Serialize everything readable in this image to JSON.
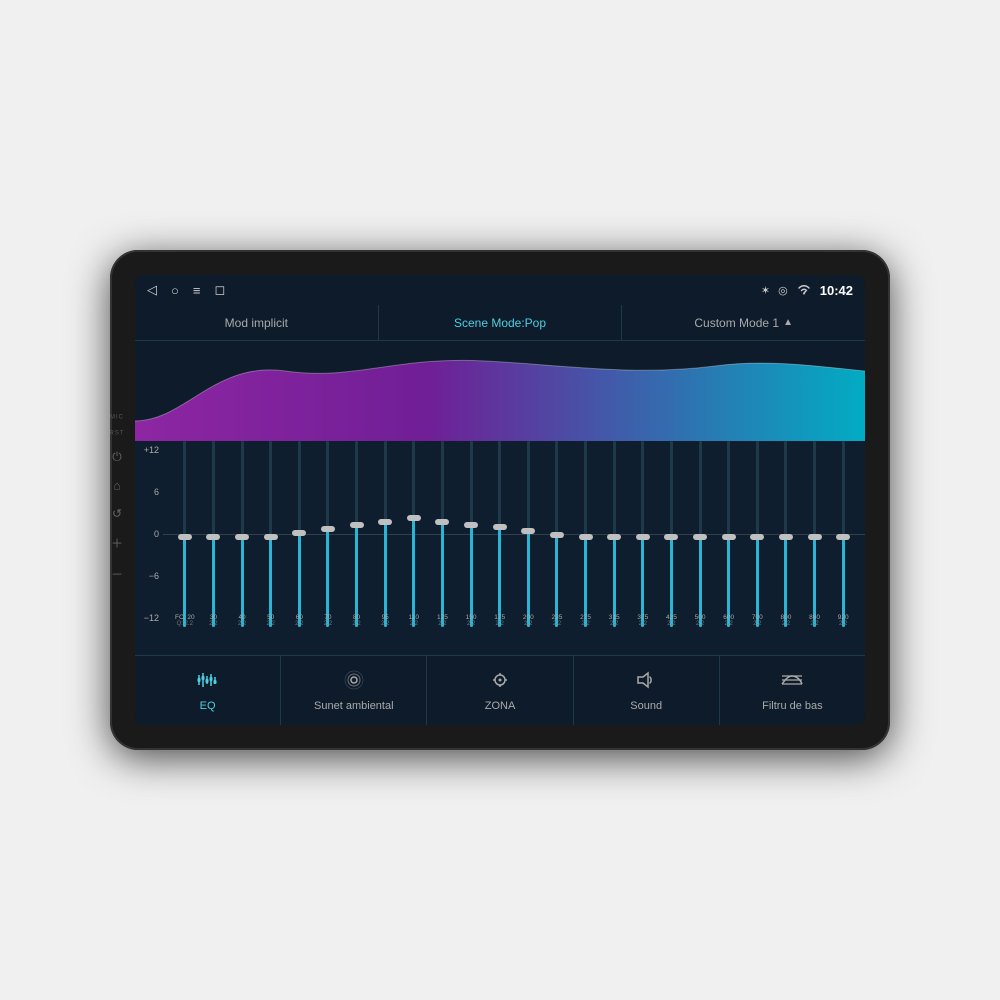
{
  "device": {
    "statusBar": {
      "time": "10:42",
      "icons": {
        "back": "◁",
        "home": "○",
        "menu": "≡",
        "recent": "◻",
        "bluetooth": "✶",
        "location": "◎",
        "wifi": "▲",
        "mic": "MIC"
      }
    },
    "modeBar": {
      "items": [
        {
          "label": "Mod implicit",
          "active": false
        },
        {
          "label": "Scene Mode:Pop",
          "active": true
        },
        {
          "label": "Custom Mode 1",
          "active": false,
          "hasArrow": true
        }
      ]
    },
    "eq": {
      "dbLabels": [
        "+12",
        "6",
        "0",
        "−6",
        "−12"
      ],
      "bands": [
        {
          "freq": "20",
          "q": "2.2",
          "value": 50
        },
        {
          "freq": "30",
          "q": "2.2",
          "value": 50
        },
        {
          "freq": "40",
          "q": "2.2",
          "value": 50
        },
        {
          "freq": "50",
          "q": "2.2",
          "value": 50
        },
        {
          "freq": "60",
          "q": "2.2",
          "value": 52
        },
        {
          "freq": "70",
          "q": "2.2",
          "value": 54
        },
        {
          "freq": "80",
          "q": "2.2",
          "value": 56
        },
        {
          "freq": "95",
          "q": "2.2",
          "value": 58
        },
        {
          "freq": "110",
          "q": "2.2",
          "value": 60
        },
        {
          "freq": "125",
          "q": "2.2",
          "value": 58
        },
        {
          "freq": "150",
          "q": "2.2",
          "value": 56
        },
        {
          "freq": "175",
          "q": "2.2",
          "value": 55
        },
        {
          "freq": "200",
          "q": "2.2",
          "value": 53
        },
        {
          "freq": "235",
          "q": "2.2",
          "value": 51
        },
        {
          "freq": "275",
          "q": "2.2",
          "value": 50
        },
        {
          "freq": "315",
          "q": "2.2",
          "value": 50
        },
        {
          "freq": "375",
          "q": "2.2",
          "value": 50
        },
        {
          "freq": "435",
          "q": "2.2",
          "value": 50
        },
        {
          "freq": "500",
          "q": "2.2",
          "value": 50
        },
        {
          "freq": "600",
          "q": "2.2",
          "value": 50
        },
        {
          "freq": "700",
          "q": "2.2",
          "value": 50
        },
        {
          "freq": "800",
          "q": "2.2",
          "value": 50
        },
        {
          "freq": "860",
          "q": "2.2",
          "value": 50
        },
        {
          "freq": "920",
          "q": "2.2",
          "value": 50
        }
      ]
    },
    "bottomNav": [
      {
        "id": "eq",
        "icon": "⚙",
        "label": "EQ",
        "active": true,
        "iconType": "sliders"
      },
      {
        "id": "sunet",
        "icon": "◎",
        "label": "Sunet ambiental",
        "active": false,
        "iconType": "ambient"
      },
      {
        "id": "zona",
        "icon": "◎",
        "label": "ZONA",
        "active": false,
        "iconType": "zone"
      },
      {
        "id": "sound",
        "icon": "🔈",
        "label": "Sound",
        "active": false,
        "iconType": "speaker"
      },
      {
        "id": "filtru",
        "icon": "≋",
        "label": "Filtru de bas",
        "active": false,
        "iconType": "bass"
      }
    ]
  }
}
